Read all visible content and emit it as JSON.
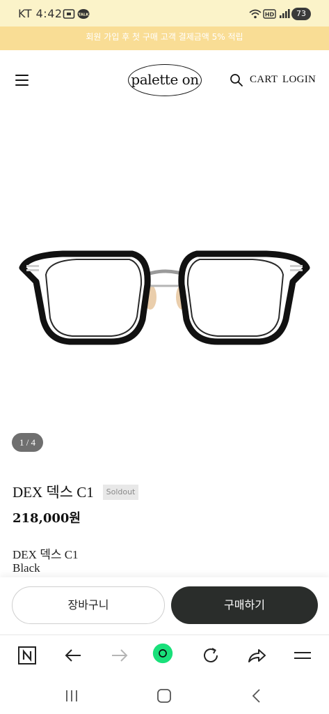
{
  "status_bar": {
    "carrier": "KT",
    "time": "4:42",
    "battery": "73",
    "hd_label": "HD",
    "talk_label": "TALK"
  },
  "promo": {
    "text": "회원 가입 후 첫 구매 고객 결제금액 5% 적립"
  },
  "header": {
    "logo": "palette on",
    "cart_label": "CART",
    "login_label": "LOGIN"
  },
  "product": {
    "image_counter": "1 / 4",
    "name": "DEX 덱스 C1",
    "badge": "Soldout",
    "price": "218,000원",
    "description": [
      "DEX 덱스 C1",
      "Black"
    ]
  },
  "actions": {
    "cart_button": "장바구니",
    "buy_button": "구매하기"
  },
  "browser_toolbar": {
    "items": [
      "naver-icon",
      "back-arrow-icon",
      "forward-arrow-icon",
      "green-dot-icon",
      "refresh-icon",
      "share-icon",
      "menu-icon"
    ],
    "accent_color": "#19e07a"
  },
  "colors": {
    "promo_bg": "#f9dd95",
    "status_bg": "#fbf3c9",
    "buy_button_bg": "#2a2d2b"
  }
}
